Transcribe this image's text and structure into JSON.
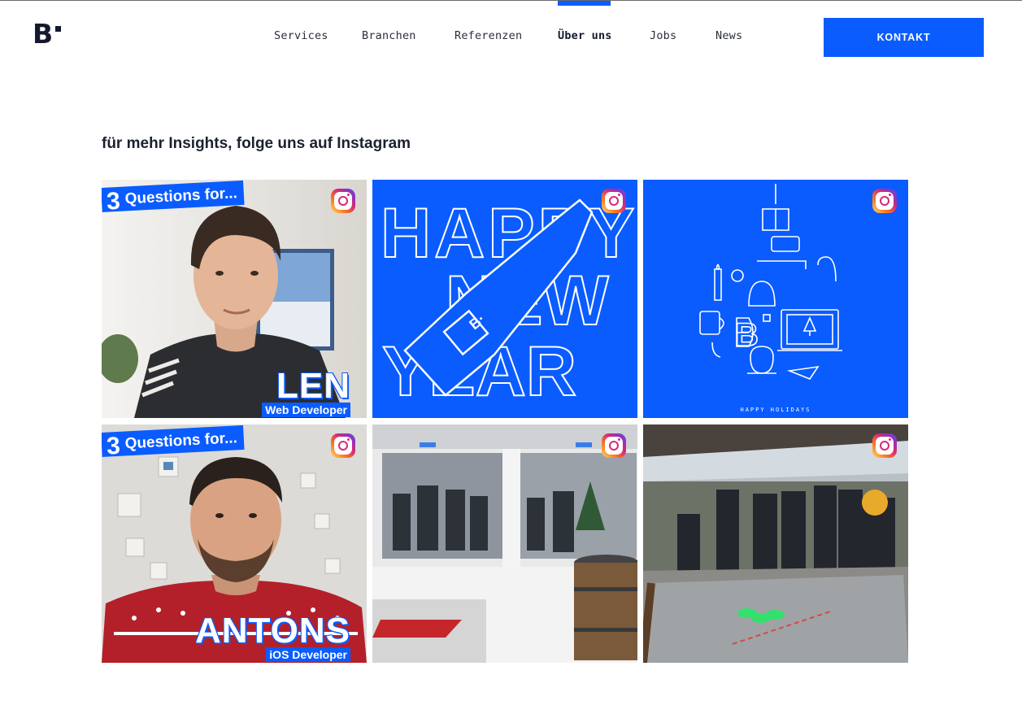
{
  "nav": {
    "items": [
      {
        "label": "Services"
      },
      {
        "label": "Branchen"
      },
      {
        "label": "Referenzen"
      },
      {
        "label": "Über uns",
        "active": true
      },
      {
        "label": "Jobs"
      },
      {
        "label": "News"
      }
    ],
    "cta_label": "KONTAKT"
  },
  "colors": {
    "accent": "#0a5cff",
    "text": "#1b2130"
  },
  "section": {
    "title": "für mehr Insights, folge uns auf Instagram"
  },
  "instagram_tiles": [
    {
      "type": "portrait",
      "banner_number": "3",
      "banner_text": "Questions for...",
      "name": "LEN",
      "role": "Web Developer",
      "icon": "instagram-icon"
    },
    {
      "type": "graphic",
      "text": "HAPPY NEW YEAR",
      "icon": "instagram-icon"
    },
    {
      "type": "graphic",
      "caption": "HAPPY HOLIDAYS",
      "icon": "instagram-icon"
    },
    {
      "type": "portrait",
      "banner_number": "3",
      "banner_text": "Questions for...",
      "name": "ANTONS",
      "role": "iOS Developer",
      "icon": "instagram-icon"
    },
    {
      "type": "photo",
      "icon": "instagram-icon"
    },
    {
      "type": "photo",
      "icon": "instagram-icon"
    }
  ]
}
